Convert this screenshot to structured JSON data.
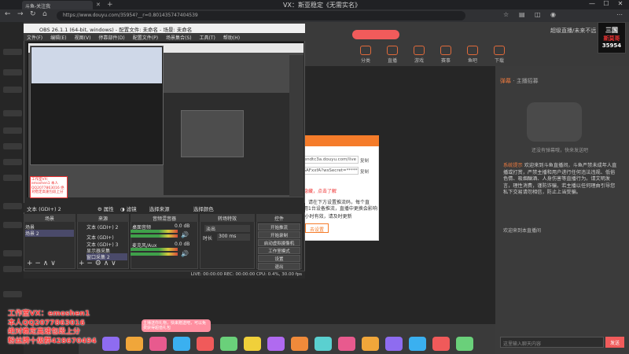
{
  "browser": {
    "tab_title": "斗鱼-关注我",
    "url": "https://www.douyu.com/35954?__r=0.801435747404539",
    "window_title": "VX：斯亚稳定《无需实名》"
  },
  "douyu": {
    "search_placeholder": "",
    "nav": [
      "分类",
      "直播",
      "游戏",
      "赛事",
      "鱼吧",
      "下载"
    ],
    "user_label": "超级直播/未来不远",
    "badge_brand": "三国",
    "badge_name": "斯莫哥",
    "badge_number": "35954"
  },
  "obs": {
    "title": "OBS 26.1.1 (64-bit, windows) - 配置文件: 未命名 - 场景: 未命名",
    "menu": [
      "文件(F)",
      "编辑(E)",
      "视图(V)",
      "停靠部件(D)",
      "配置文件(P)",
      "场景集合(S)",
      "工具(T)",
      "帮助(H)"
    ],
    "status_row": "文本 (GDI+) 2",
    "status_props": "属性",
    "status_filters": "滤镜",
    "status_image": "选择来源",
    "status_color": "选择颜色",
    "docks": {
      "scenes": "场景",
      "sources": "来源",
      "mixer": "音频混音器",
      "transitions": "转场特效",
      "controls": "控件"
    },
    "scenes": [
      "场景",
      "场景 2"
    ],
    "sources": [
      "文本 (GDI+) 2",
      "文本 (GDI+)",
      "文本 (GDI+) 3",
      "显示器采集",
      "窗口采集 2"
    ],
    "mixer": [
      {
        "name": "桌面音频",
        "db": "0.0 dB"
      },
      {
        "name": "麦克风/Aux",
        "db": "0.0 dB"
      }
    ],
    "transition": "淡出",
    "duration_label": "时长",
    "duration": "300 ms",
    "controls": [
      "开始推流",
      "开始录制",
      "启动虚拟摄像机",
      "工作室模式",
      "设置",
      "退出"
    ],
    "footer": "LIVE: 00:00:00   REC: 00:00:00   CPU: 0.4%, 30.00 fps",
    "overlay_text": "工作室VX：emoshen1 本人QQ2077863016 绝对稳定高速包段上分"
  },
  "dialog": {
    "line1": "rtmp://sendtc3a.douyu.com/live",
    "copy1": "复制",
    "line2": "35954rGAFxxfA?wsSecret=******",
    "copy2": "复制",
    "tip": "推流码已隐藏，点击了解",
    "tip2": "如需直播，请在下方设置推流码，每个直",
    "tip3": "播间只能用1台设备推流，直播中更换会影响",
    "tip4": "推流码24小时有效，请及时更新",
    "button": "去设置"
  },
  "chat": {
    "tabs_label": "主播招募",
    "tab_active": "弹幕",
    "empty_text": "还没有弹幕哦，快来发送吧",
    "system_label": "系统提示",
    "message": "欢迎来到斗鱼直播间，斗鱼严禁未成年人直播或打赏，严禁主播和用户进行任何违法违规、低俗色情、吸烟酗酒、人身伤害等直播行为。请文明发言，理性消费，谨防诈骗，若主播以任何理由引导您私下交易请勿相信，防止上当受骗。",
    "line2": "欢迎来到本直播间",
    "input_placeholder": "这里输入聊天内容",
    "send": "发送"
  },
  "promo": {
    "line1": "工作室VX：emoshen1",
    "line2": "本人QQ2077863016",
    "line3": "绝对稳定高速包段上分",
    "line4": "粉丝牌十级群428670494"
  },
  "gift_banner": "主播送你礼物，快来赠送吧，可以免费获得超值礼包"
}
